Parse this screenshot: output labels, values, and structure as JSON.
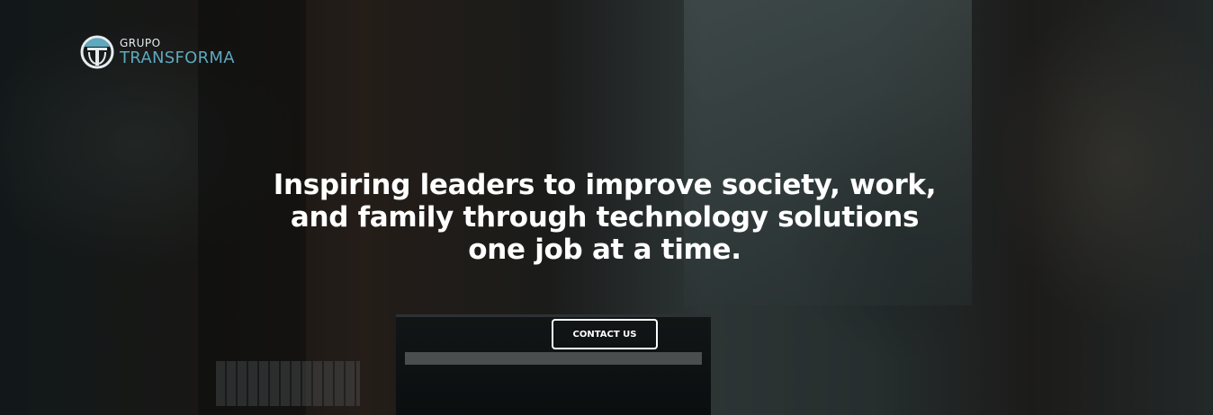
{
  "brand": {
    "top_text": "GRUPO",
    "bottom_text": "TRANSFORMA",
    "accent_color": "#5fa8be",
    "logo_icon": "grupo-transforma-logo-icon"
  },
  "hero": {
    "headline": "Inspiring leaders to improve society, work, and family through technology solutions one job at a time.",
    "cta_label": "CONTACT US",
    "background": "photo of people working on laptops with dark overlay"
  }
}
